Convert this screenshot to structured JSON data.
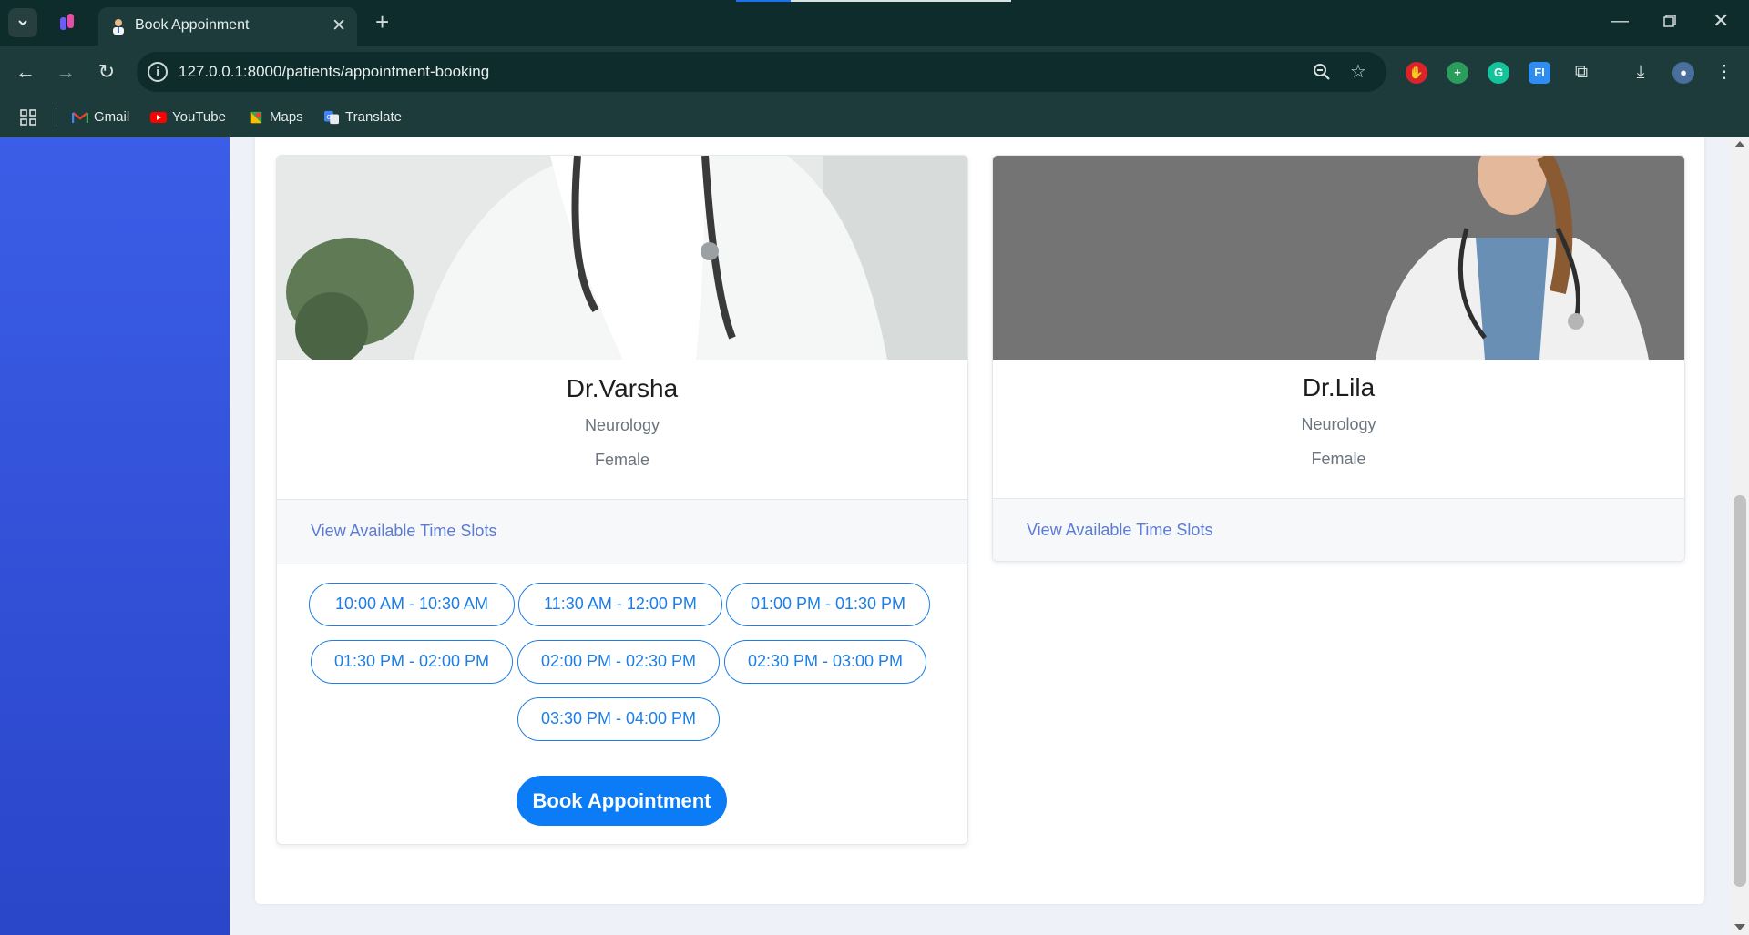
{
  "browser": {
    "tab_title": "Book Appoinment",
    "url": "127.0.0.1:8000/patients/appointment-booking",
    "bookmarks": [
      {
        "label": "Gmail",
        "icon": "gmail-icon"
      },
      {
        "label": "YouTube",
        "icon": "youtube-icon"
      },
      {
        "label": "Maps",
        "icon": "maps-icon"
      },
      {
        "label": "Translate",
        "icon": "translate-icon"
      }
    ]
  },
  "doctors": [
    {
      "name": "Dr.Varsha",
      "specialty": "Neurology",
      "gender": "Female",
      "slots_link": "View Available Time Slots",
      "slots": [
        "10:00 AM - 10:30 AM",
        "11:30 AM - 12:00 PM",
        "01:00 PM - 01:30 PM",
        "01:30 PM - 02:00 PM",
        "02:00 PM - 02:30 PM",
        "02:30 PM - 03:00 PM",
        "03:30 PM - 04:00 PM"
      ],
      "book_label": "Book Appointment"
    },
    {
      "name": "Dr.Lila",
      "specialty": "Neurology",
      "gender": "Female",
      "slots_link": "View Available Time Slots"
    }
  ],
  "colors": {
    "sidebar": "#3b5de7",
    "accent": "#0b7cf5",
    "slot_border": "#1c7ee6",
    "link": "#5b7bd5"
  }
}
